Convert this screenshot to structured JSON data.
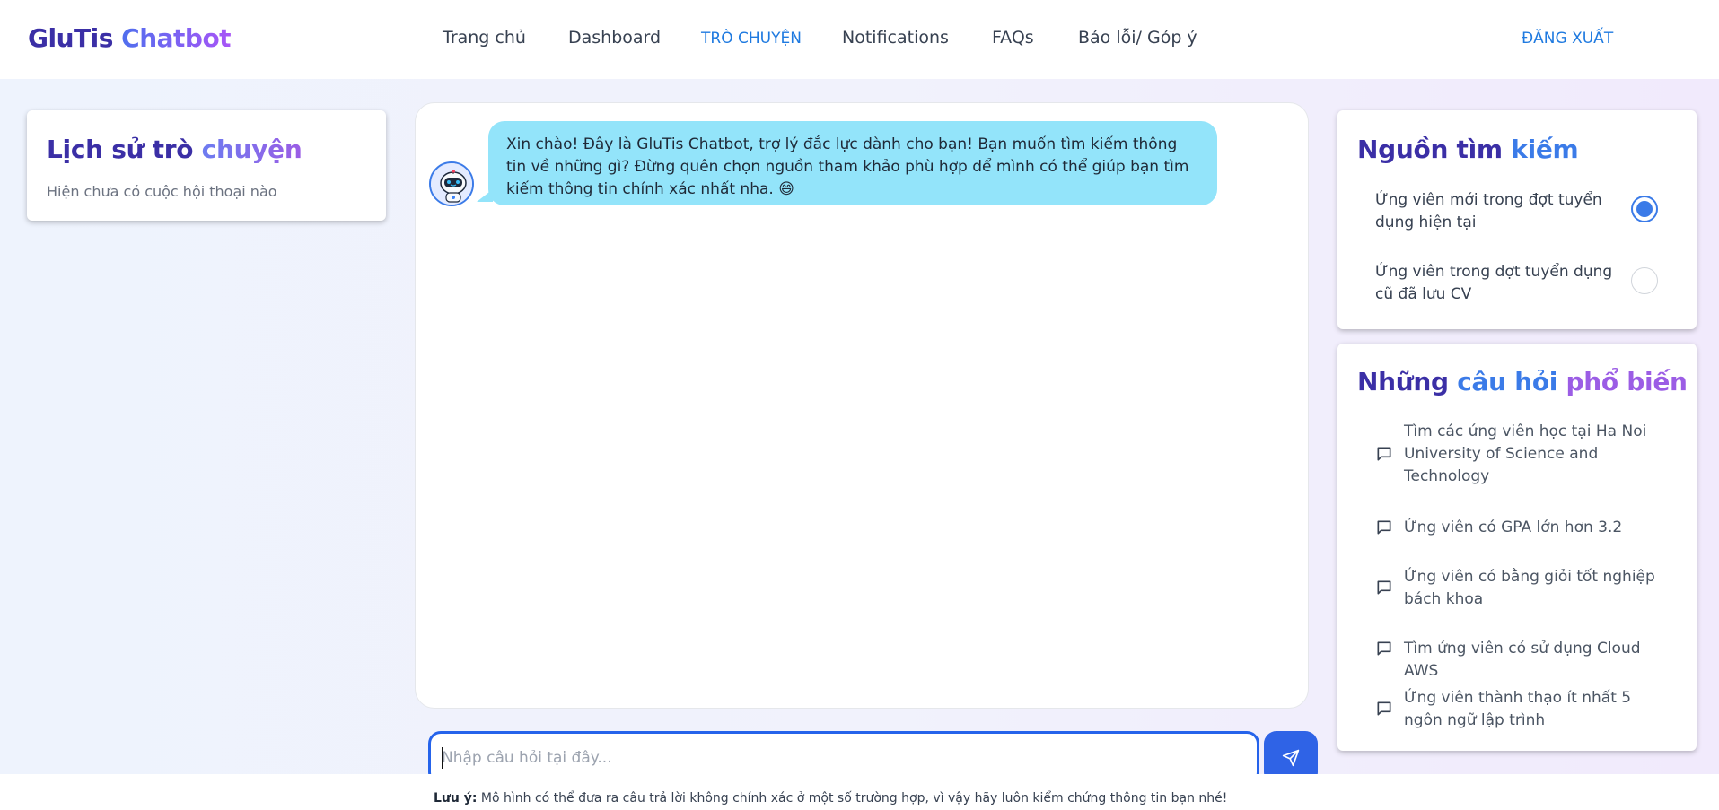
{
  "header": {
    "brand_part1": "GluTis",
    "brand_part2": "Chatbot",
    "nav": [
      "Trang chủ",
      "Dashboard",
      "TRÒ CHUYỆN",
      "Notifications",
      "FAQs",
      "Báo lỗi/ Góp ý"
    ],
    "active_nav": "TRÒ CHUYỆN",
    "logout_label": "ĐĂNG XUẤT"
  },
  "history": {
    "title_part1": "Lịch sử trò ",
    "title_part2": "chuyện",
    "empty_text": "Hiện chưa có cuộc hội thoại nào"
  },
  "chat": {
    "messages": [
      {
        "sender": "bot",
        "text": "Xin chào! Đây là GluTis Chatbot, trợ lý đắc lực dành cho bạn! Bạn muốn tìm kiếm thông tin về những gì? Đừng quên chọn nguồn tham khảo phù hợp để mình có thể giúp bạn tìm kiếm thông tin chính xác nhất nha. 😄"
      }
    ],
    "input_placeholder": "Nhập câu hỏi tại đây...",
    "note_label": "Lưu ý:",
    "note_text": " Mô hình có thể đưa ra câu trả lời không chính xác ở một số trường hợp, vì vậy hãy luôn kiểm chứng thông tin bạn nhé!"
  },
  "sources": {
    "title_part1": "Nguồn ",
    "title_part2": "tìm ",
    "title_part3": "kiếm",
    "options": [
      {
        "label": "Ứng viên mới trong đợt tuyển dụng hiện tại",
        "selected": true
      },
      {
        "label": "Ứng viên trong đợt tuyển dụng cũ đã lưu CV",
        "selected": false
      }
    ]
  },
  "faq": {
    "title_part1": "Những ",
    "title_part2": "câu ",
    "title_part3": "hỏi ",
    "title_part4": "phổ biến",
    "items": [
      "Tìm các ứng viên học tại Ha Noi University of Science and Technology",
      "Ứng viên có GPA lớn hơn 3.2",
      "Ứng viên có bằng giỏi tốt nghiệp bách khoa",
      "Tìm ứng viên có sử dụng Cloud AWS",
      "Ứng viên thành thạo ít nhất 5 ngôn ngữ lập trình"
    ]
  },
  "colors": {
    "accent": "#1f7ae0",
    "bubble": "#93e4fa",
    "brand_dark": "#3b2fa6",
    "send_button": "#2f63e6"
  }
}
